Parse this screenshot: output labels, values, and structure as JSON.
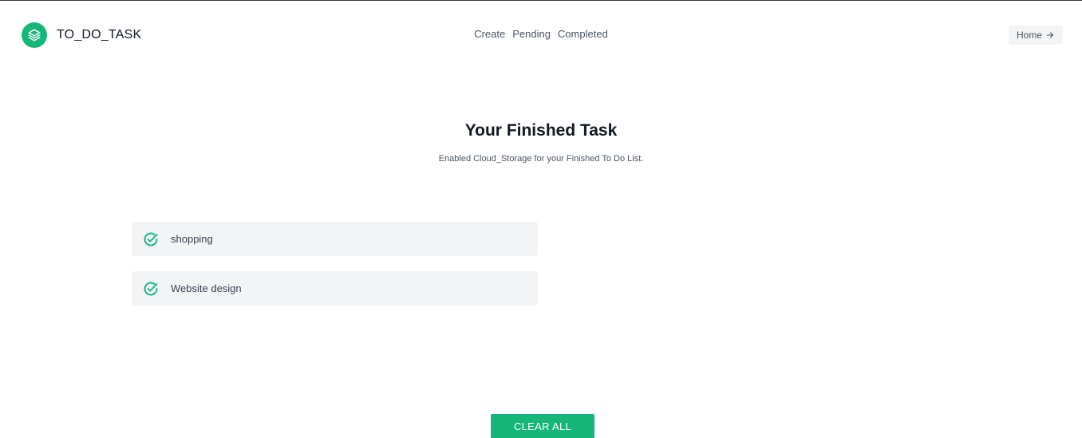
{
  "header": {
    "brand": "TO_DO_TASK",
    "logo_icon": "layers-icon",
    "nav": [
      {
        "label": "Create"
      },
      {
        "label": "Pending"
      },
      {
        "label": "Completed"
      }
    ],
    "home_label": "Home",
    "home_icon": "arrow-right-icon"
  },
  "main": {
    "title": "Your Finished Task",
    "subtitle": "Enabled Cloud_Storage for your Finished To Do List.",
    "tasks": [
      {
        "label": "shopping",
        "icon": "check-circle-icon"
      },
      {
        "label": "Website design",
        "icon": "check-circle-icon"
      }
    ],
    "clear_label": "CLEAR ALL"
  },
  "colors": {
    "accent": "#16b67a",
    "task_bg": "#f3f4f6"
  }
}
